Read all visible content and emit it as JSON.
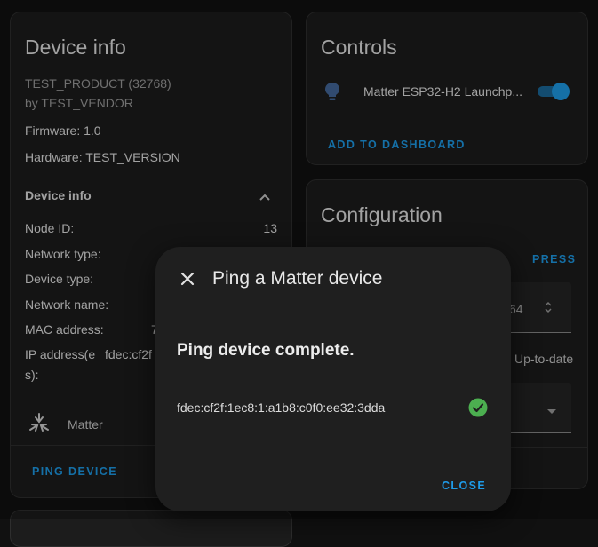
{
  "device_info": {
    "title": "Device info",
    "product": "TEST_PRODUCT (32768)",
    "vendor": "by TEST_VENDOR",
    "firmware": "Firmware: 1.0",
    "hardware": "Hardware: TEST_VERSION",
    "section_title": "Device info",
    "rows": [
      {
        "label": "Node ID:",
        "value": "13"
      },
      {
        "label": "Network type:",
        "value": ""
      },
      {
        "label": "Device type:",
        "value": ""
      },
      {
        "label": "Network name:",
        "value": ""
      },
      {
        "label": "MAC address:",
        "value": "7"
      },
      {
        "label": "IP address(e",
        "label2": "s):",
        "value": "fdec:cf2f"
      }
    ],
    "integration": "Matter",
    "ping_button": "PING DEVICE"
  },
  "controls": {
    "title": "Controls",
    "entity_name": "Matter ESP32-H2 Launchp...",
    "toggle_on": true,
    "add_button": "ADD TO DASHBOARD"
  },
  "configuration": {
    "title": "Configuration",
    "press_button": "PRESS",
    "number_value": "64",
    "update_status": "Up-to-date"
  },
  "dialog": {
    "title": "Ping a Matter device",
    "status": "Ping device complete.",
    "address": "fdec:cf2f:1ec8:1:a1b8:c0f0:ee32:3dda",
    "close_button": "CLOSE"
  },
  "colors": {
    "accent": "#1e9be8",
    "success": "#4caf50",
    "toggle_track": "#1b6a9c",
    "background": "#111111",
    "card": "#1c1c1c"
  }
}
